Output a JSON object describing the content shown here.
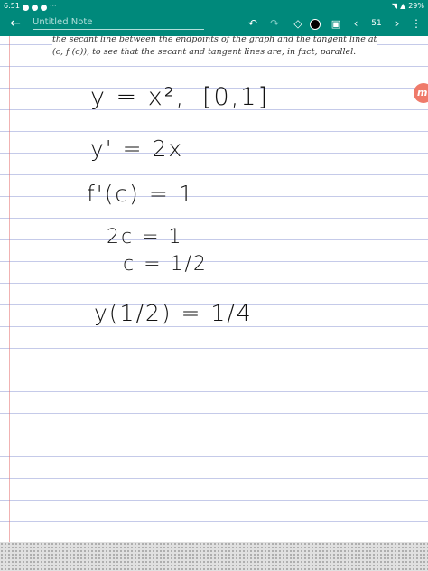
{
  "status_bar": {
    "time": "6:51",
    "battery": "29%"
  },
  "toolbar": {
    "title": "Untitled Note",
    "page_number": "51",
    "icons": [
      "back-arrow-icon",
      "undo-icon",
      "redo-icon",
      "pen-color-icon",
      "image-icon",
      "chevron-left-icon",
      "chevron-right-icon",
      "more-vert-icon"
    ]
  },
  "note": {
    "problem_text_line1": "the secant line between the endpoints of the graph and the tangent line at",
    "problem_text_line2": "(c, f (c)), to see that the secant and tangent lines are, in fact, parallel.",
    "handwriting": {
      "line1": "y = x²,",
      "line1_interval": "[0,1]",
      "line2": "y' = 2x",
      "line3": "f'(c) = 1",
      "line4": "2c = 1",
      "line5": "c = 1/2",
      "line6": "y(1/2) = 1/4"
    }
  },
  "logo": {
    "glyph": "m",
    "color": "#ef7a6a"
  },
  "colors": {
    "toolbar": "#00897b",
    "ruled_line": "#c5cae9",
    "margin_line": "#e57373"
  }
}
